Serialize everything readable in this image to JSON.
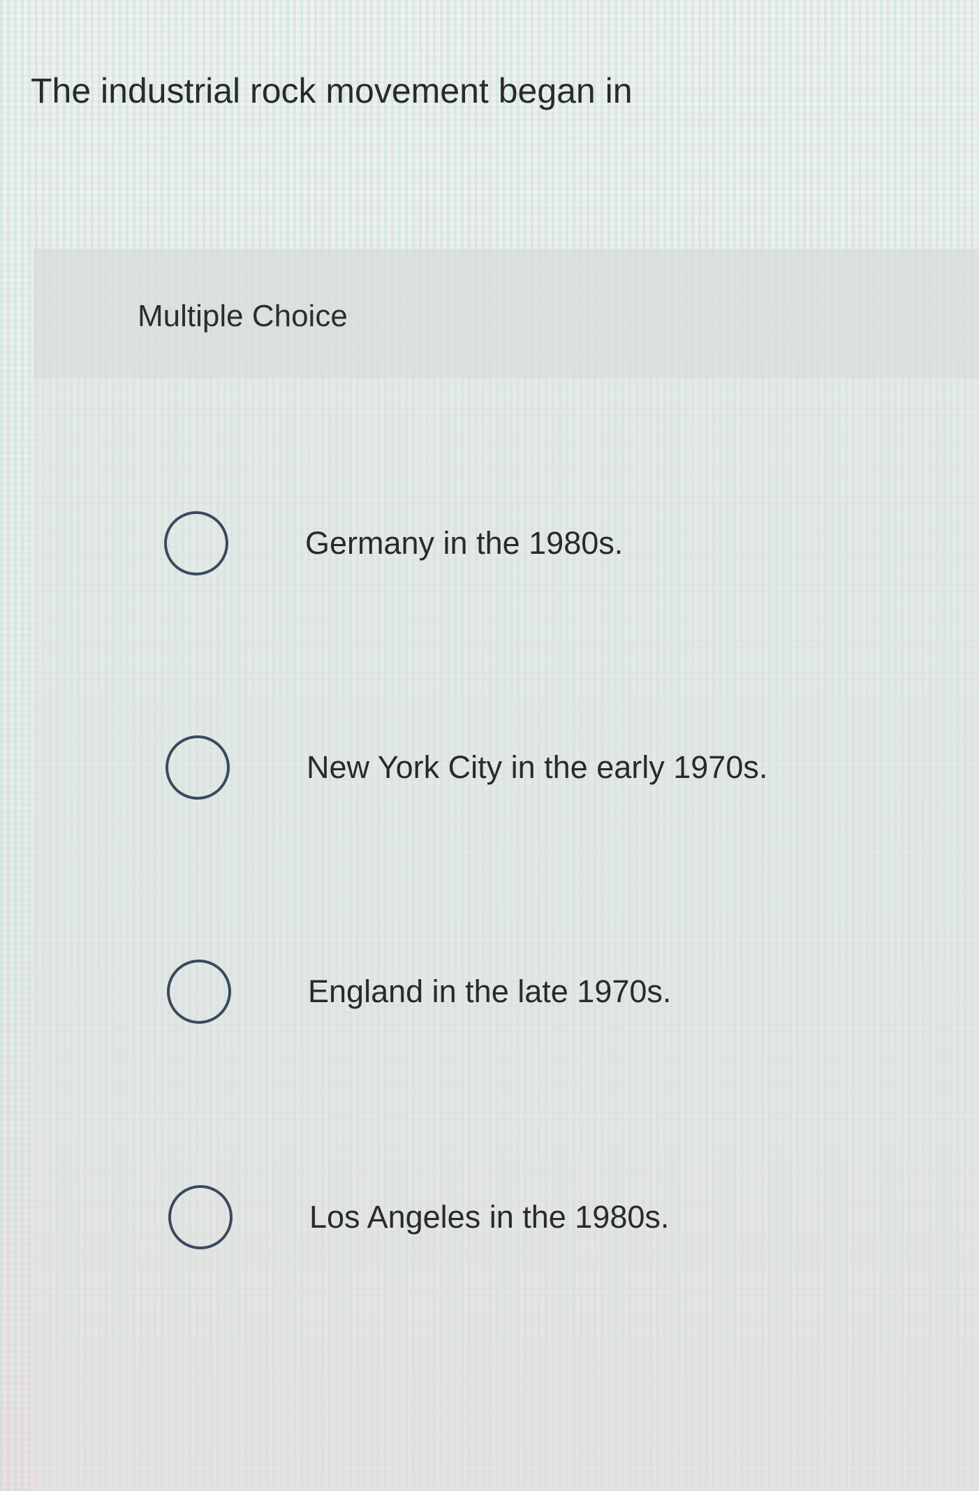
{
  "question": {
    "text": "The industrial rock movement began in"
  },
  "multiple_choice": {
    "label": "Multiple Choice",
    "options": [
      {
        "label": "Germany in the 1980s.",
        "selected": false
      },
      {
        "label": "New York City in the early 1970s.",
        "selected": false
      },
      {
        "label": "England in the late 1970s.",
        "selected": false
      },
      {
        "label": "Los Angeles in the 1980s.",
        "selected": false
      }
    ]
  }
}
